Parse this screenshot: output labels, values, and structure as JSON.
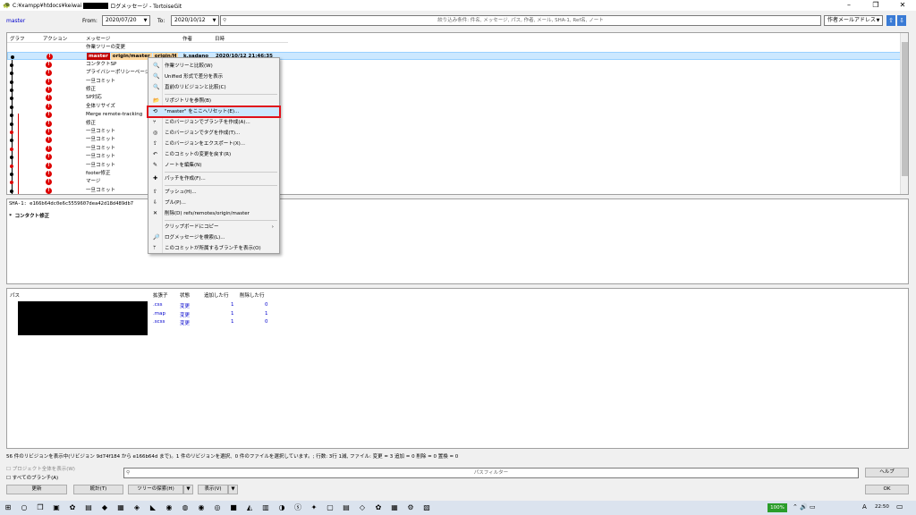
{
  "title": {
    "path": "C:¥xampp¥htdocs¥keiwai",
    "suffix": "ログメッセージ - TortoiseGit"
  },
  "filter": {
    "branch": "master",
    "from_label": "From:",
    "from": "2020/07/20",
    "to_label": "To:",
    "to": "2020/10/12",
    "search_placeholder": "絞り込み条件: 件名, メッセージ, パス, 作者, メール, SHA-1, Ref名, ノート",
    "search_field": "作者メールアドレス"
  },
  "columns": {
    "graph": "グラフ",
    "action": "アクション",
    "message": "メッセージ",
    "author": "作者",
    "date": "日時"
  },
  "selected": {
    "ref1": "master",
    "ref2": "origin/master",
    "ref3": "origin/H",
    "author": "k.sadano",
    "date": "2020/10/12 21:46:35"
  },
  "commits": [
    "作業ツリーの変更",
    "",
    "コンタクトSP",
    "プライバシーポリシーページSP",
    "一旦コミット",
    "修正",
    "SP対応",
    "全体リサイズ",
    "Merge remote-tracking",
    "修正",
    "一旦コミット",
    "一旦コミット",
    "一旦コミット",
    "一旦コミット",
    "一旦コミット",
    "footer修正",
    "マージ",
    "一旦コミット"
  ],
  "detail": {
    "sha": "SHA-1: e166b64dc0e6c5559607dea42d18d489db7",
    "msg": "* コンタクト修正"
  },
  "files": {
    "headers": {
      "path": "パス",
      "ext": "拡張子",
      "status": "状態",
      "added": "追加した行",
      "deleted": "削除した行"
    },
    "rows": [
      {
        "ext": ".css",
        "status": "変更",
        "added": "1",
        "deleted": "0"
      },
      {
        "ext": ".map",
        "status": "変更",
        "added": "1",
        "deleted": "1"
      },
      {
        "ext": ".scss",
        "status": "変更",
        "added": "1",
        "deleted": "0"
      }
    ]
  },
  "status": "56 件のリビジョンを表示中(リビジョン 9d74f184 から e166b64d まで)。1 件のリビジョンを選択、0 件のファイルを選択しています。; 行数: 3行 1減, ファイル: 変更 = 3 追加 = 0 削除 = 0 置換 = 0",
  "bottom": {
    "whole_project": "プロジェクト全体を表示(W)",
    "all_branches": "すべてのブランチ(A)",
    "path_filter": "パスフィルター",
    "help": "ヘルプ",
    "refresh": "更新",
    "stats": "統計(T)",
    "tree": "ツリーの探索(H)",
    "view": "表示(V)",
    "ok": "OK"
  },
  "menu": [
    "作業ツリーと比較(W)",
    "Unified 形式で差分を表示",
    "直前のリビジョンと比較(C)",
    "リポジトリを参照(B)",
    "\"master\" をここへリセット(E)...",
    "このバージョンでブランチを作成(A)...",
    "このバージョンでタグを作成(T)...",
    "このバージョンをエクスポート(X)...",
    "このコミットの変更を戻す(R)",
    "ノートを編集(N)",
    "パッチを作成(F)...",
    "プッシュ(H)...",
    "プル(P)...",
    "削除(D) refs/remotes/origin/master",
    "クリップボードにコピー",
    "ログメッセージを検索(L)...",
    "このコミットが所属するブランチを表示(O)"
  ],
  "taskbar": {
    "battery": "100%",
    "lang": "A",
    "time": "22:50"
  }
}
